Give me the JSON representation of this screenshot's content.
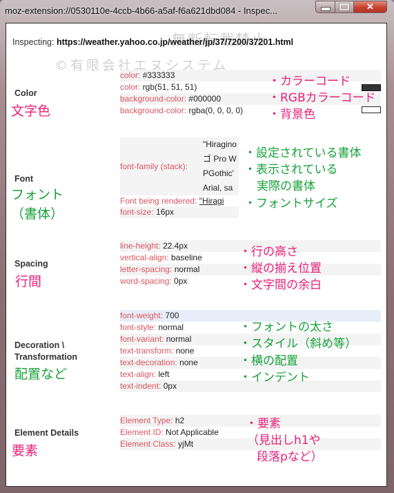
{
  "window": {
    "title": "moz-extension://0530110e-4ccb-4b66-a5af-f6a621dbd084 - Inspec...",
    "buttons": {
      "minimize": "minimize",
      "maximize": "maximize",
      "close": "close"
    }
  },
  "inspecting": {
    "label": "Inspecting:",
    "url": "https://weather.yahoo.co.jp/weather/jp/37/7200/37201.html"
  },
  "watermark": {
    "line1": "無断転載禁止",
    "line2": "©有限会社エヌシステム"
  },
  "sections": {
    "color": {
      "label": "Color",
      "annotation": "文字色",
      "rows": [
        {
          "key": "color:",
          "value": "#333333"
        },
        {
          "key": "color:",
          "value": "rgb(51, 51, 51)"
        },
        {
          "key": "background-color:",
          "value": "#000000"
        },
        {
          "key": "background-color:",
          "value": "rgba(0, 0, 0, 0)"
        }
      ],
      "notes": [
        "・カラーコード",
        "・RGBカラーコード",
        "・背景色"
      ],
      "swatches": {
        "text_color": "#333333",
        "background_color": "rgba(0,0,0,0)"
      }
    },
    "font": {
      "label": "Font",
      "annotation_line1": "フォント",
      "annotation_line2": "（書体）",
      "family_key": "font-family (stack):",
      "family_value_lines": [
        "\"Hiragino",
        "ゴ Pro W",
        "PGothic'",
        "Arial, sa"
      ],
      "rendered_key": "Font being rendered:",
      "rendered_value": "\"Hiragi",
      "size_key": "font-size:",
      "size_value": "16px",
      "notes": [
        "・設定されている書体",
        "・表示されている",
        "実際の書体",
        "・フォントサイズ"
      ]
    },
    "spacing": {
      "label": "Spacing",
      "annotation": "行間",
      "rows": [
        {
          "key": "line-height:",
          "value": "22.4px"
        },
        {
          "key": "vertical-align:",
          "value": "baseline"
        },
        {
          "key": "letter-spacing:",
          "value": "normal"
        },
        {
          "key": "word-spacing:",
          "value": "0px"
        }
      ],
      "notes": [
        "・行の高さ",
        "・縦の揃え位置",
        "・文字間の余白"
      ]
    },
    "decoration": {
      "label_line1": "Decoration \\",
      "label_line2": "Transformation",
      "annotation": "配置など",
      "rows": [
        {
          "key": "font-weight:",
          "value": "700"
        },
        {
          "key": "font-style:",
          "value": "normal"
        },
        {
          "key": "font-variant:",
          "value": "normal"
        },
        {
          "key": "text-transform:",
          "value": "none"
        },
        {
          "key": "text-decoration:",
          "value": "none"
        },
        {
          "key": "text-align:",
          "value": "left"
        },
        {
          "key": "text-indent:",
          "value": "0px"
        }
      ],
      "notes": [
        "・フォントの太さ",
        "・スタイル（斜め等）",
        "・横の配置",
        "・インデント"
      ]
    },
    "element": {
      "label": "Element Details",
      "annotation": "要素",
      "rows": [
        {
          "key": "Element Type:",
          "value": "h2"
        },
        {
          "key": "Element ID:",
          "value": "Not Applicable"
        },
        {
          "key": "Element Class:",
          "value": "yjMt"
        }
      ],
      "notes": [
        "・要素",
        "（見出しh1や",
        "段落pなど）"
      ]
    }
  }
}
